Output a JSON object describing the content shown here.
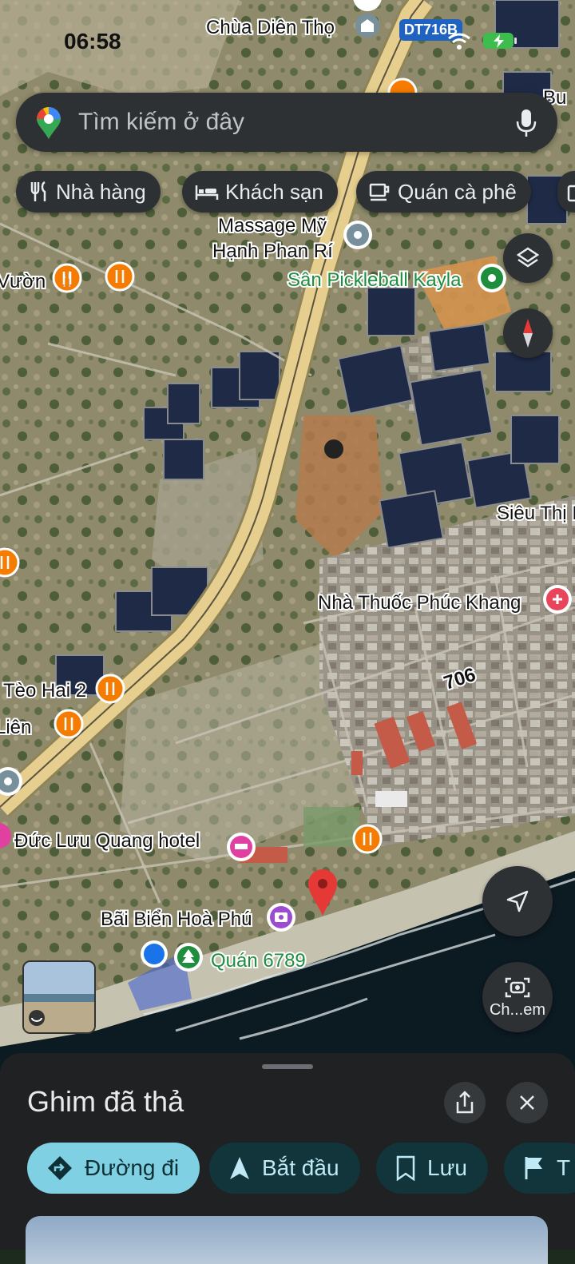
{
  "status_bar": {
    "time": "06:58",
    "route_badge": "DT716B"
  },
  "search": {
    "placeholder": "Tìm kiếm ở đây"
  },
  "chips": [
    {
      "label": "Nhà hàng",
      "icon": "fork-knife-icon"
    },
    {
      "label": "Khách sạn",
      "icon": "bed-icon"
    },
    {
      "label": "Quán cà phê",
      "icon": "coffee-cup-icon"
    }
  ],
  "map": {
    "road_number": "706",
    "places": [
      "Chùa Diên Thọ",
      "Massage Mỹ",
      "Hạnh Phan Rí",
      "Sân Pickleball Kayla",
      "Vườn",
      "Siêu Thị I",
      "Nhà Thuốc Phúc Khang",
      "Tèo Hai 2",
      "Liên",
      "Đức Lưu Quang hotel",
      "Bãi Biển Hoà Phú",
      "Quán 6789",
      "Bu"
    ]
  },
  "lens_button": {
    "label": "Ch...em"
  },
  "sheet": {
    "title": "Ghim đã thả",
    "actions": [
      {
        "label": "Đường đi",
        "icon": "directions-icon"
      },
      {
        "label": "Bắt đầu",
        "icon": "navigation-arrow-icon"
      },
      {
        "label": "Lưu",
        "icon": "bookmark-icon"
      },
      {
        "label": "T",
        "icon": "flag-icon"
      }
    ]
  },
  "colors": {
    "sheet_bg": "#1f2123",
    "primary_action": "#7fd0e3",
    "secondary_action": "#12353c",
    "pin_red": "#e53935",
    "location_blue": "#1a73e8",
    "restaurant_orange": "#f57c00",
    "hotel_pink": "#e040a0"
  }
}
